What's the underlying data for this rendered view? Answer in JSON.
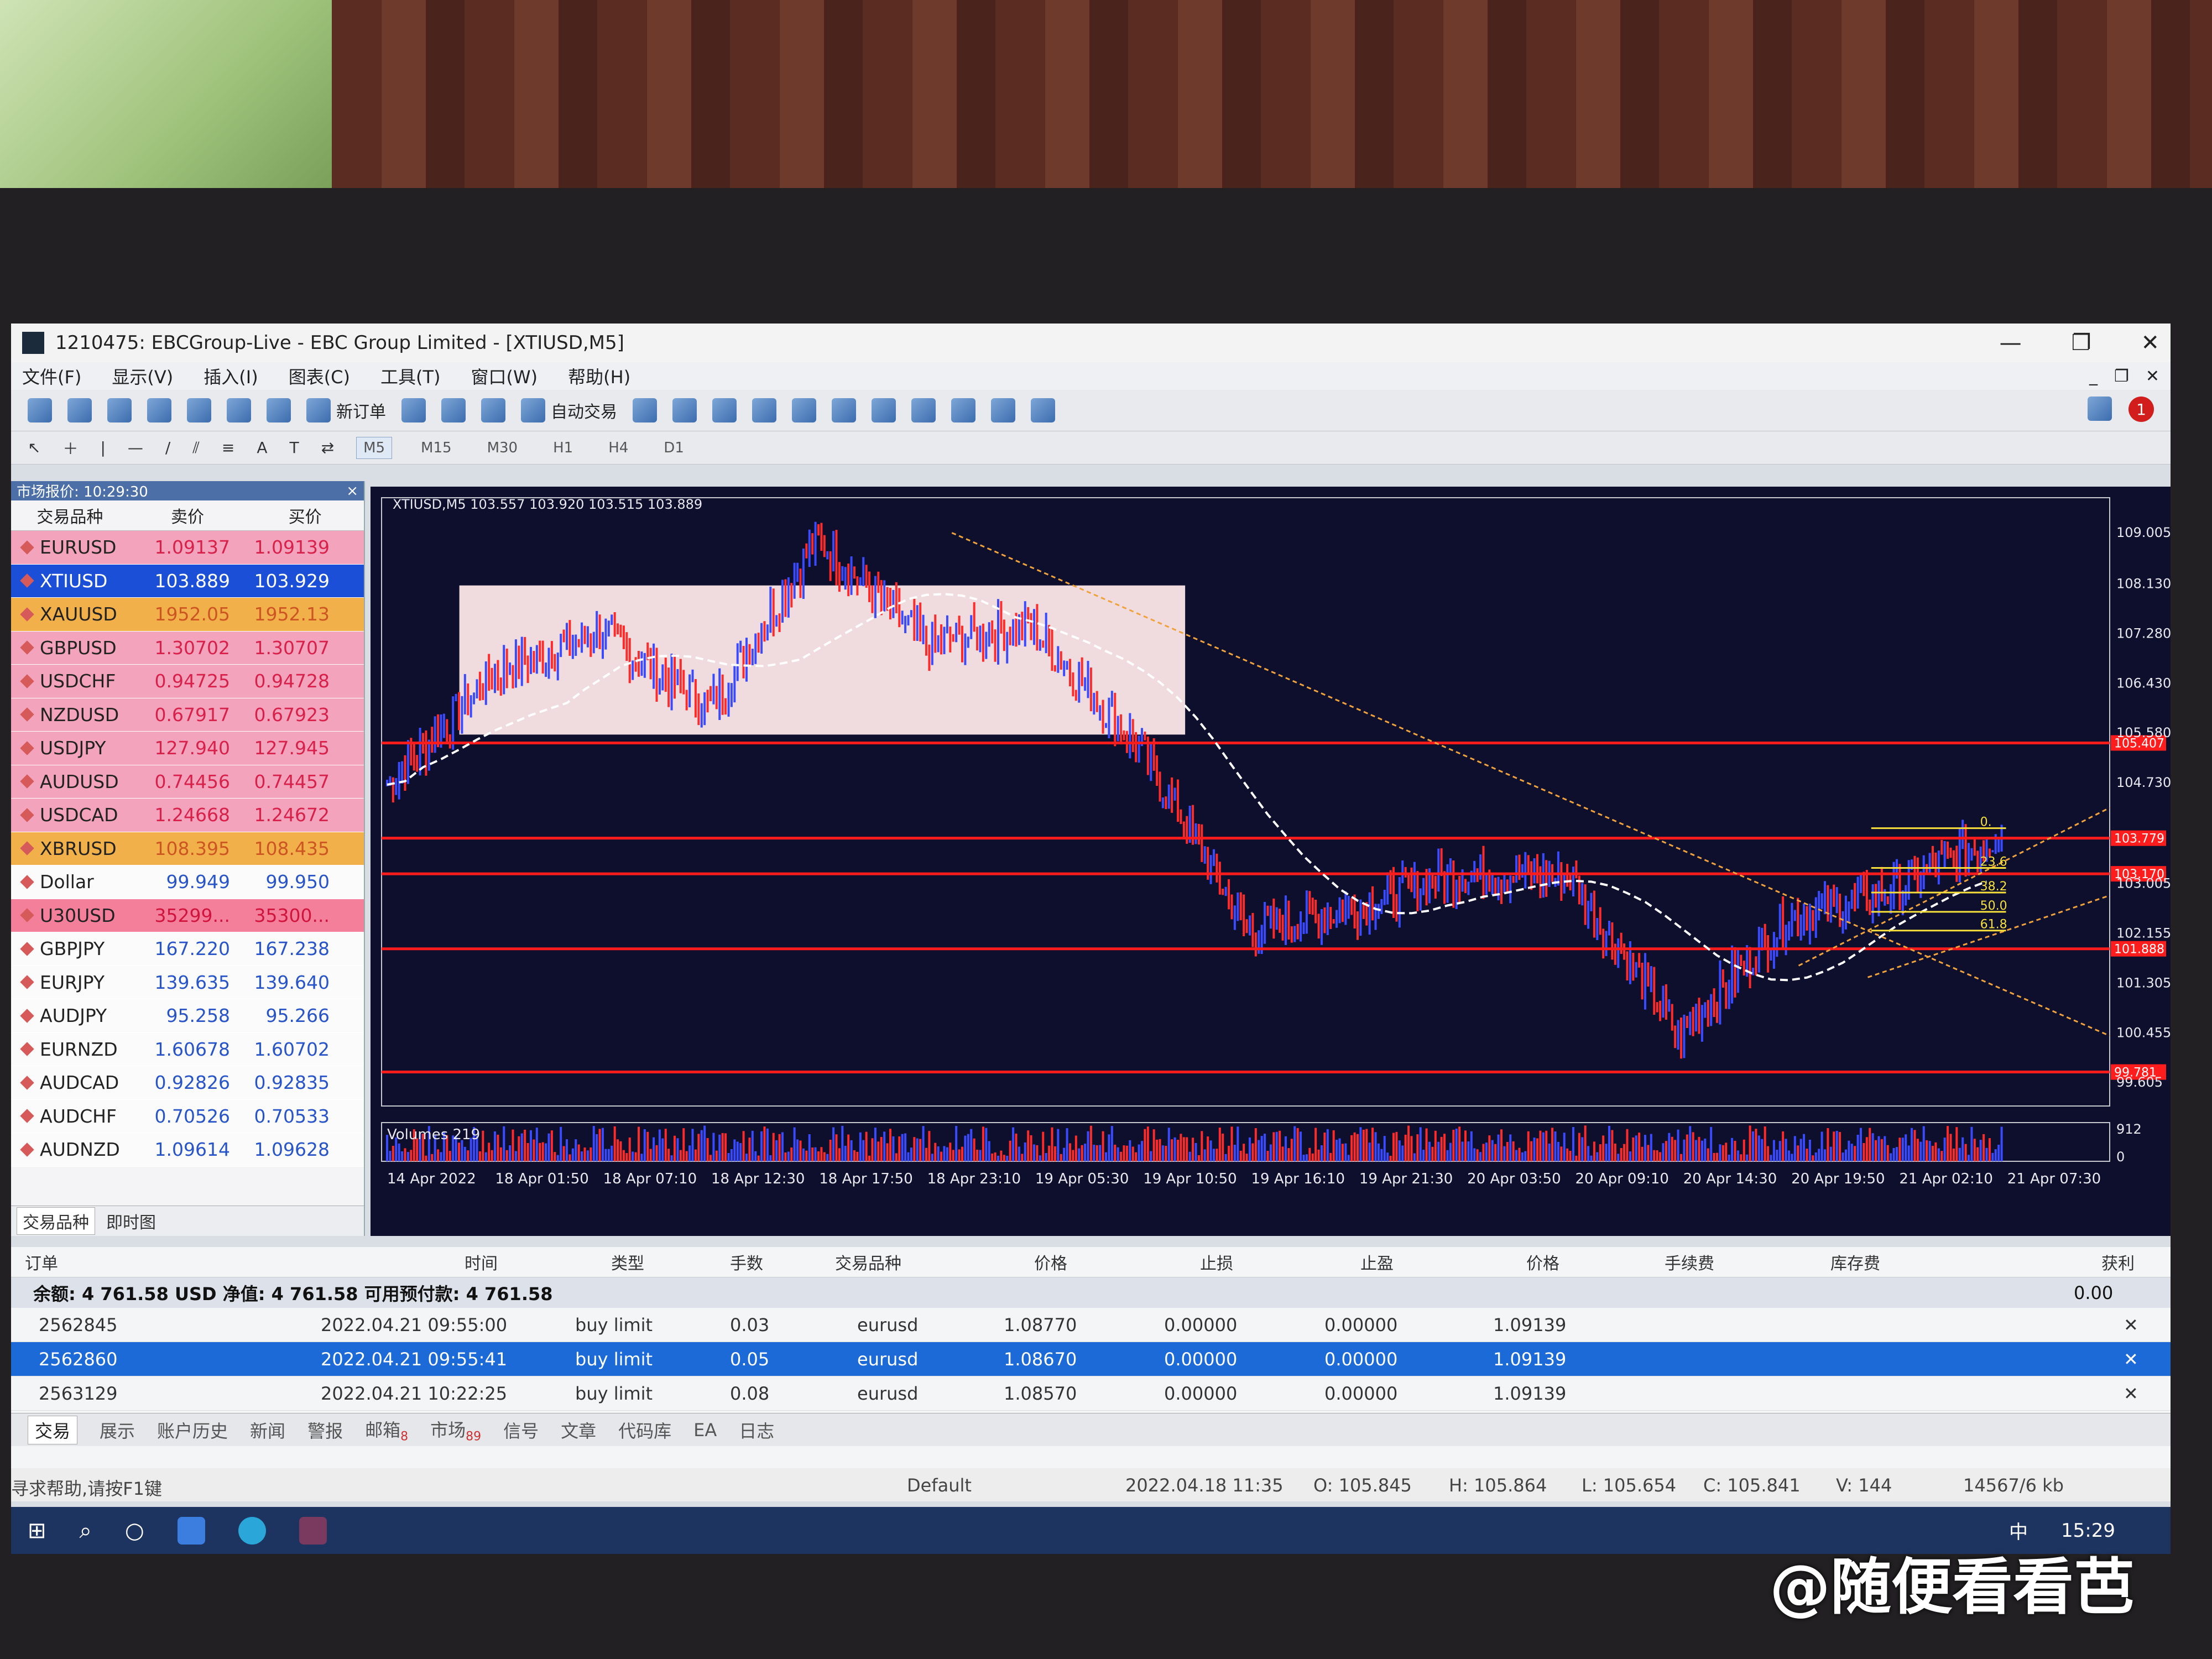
{
  "window": {
    "title": "1210475: EBCGroup-Live - EBC Group Limited - [XTIUSD,M5]",
    "min": "—",
    "max": "❐",
    "close": "✕"
  },
  "menu": [
    "文件(F)",
    "显示(V)",
    "插入(I)",
    "图表(C)",
    "工具(T)",
    "窗口(W)",
    "帮助(H)"
  ],
  "mdi": [
    "_",
    "❐",
    "✕"
  ],
  "toolbar": {
    "new_order": "新订单",
    "auto_trade": "自动交易",
    "alert_count": "1"
  },
  "timeframes": [
    "M5",
    "M15",
    "M30",
    "H1",
    "H4",
    "D1"
  ],
  "market": {
    "header": "市场报价: 10:29:30",
    "close": "×",
    "columns": [
      "交易品种",
      "卖价",
      "买价"
    ],
    "rows": [
      {
        "symbol": "EURUSD",
        "bid": "1.09137",
        "ask": "1.09139",
        "style": "pink"
      },
      {
        "symbol": "XTIUSD",
        "bid": "103.889",
        "ask": "103.929",
        "style": "sel"
      },
      {
        "symbol": "XAUUSD",
        "bid": "1952.05",
        "ask": "1952.13",
        "style": "orange"
      },
      {
        "symbol": "GBPUSD",
        "bid": "1.30702",
        "ask": "1.30707",
        "style": "pink"
      },
      {
        "symbol": "USDCHF",
        "bid": "0.94725",
        "ask": "0.94728",
        "style": "pink"
      },
      {
        "symbol": "NZDUSD",
        "bid": "0.67917",
        "ask": "0.67923",
        "style": "pink"
      },
      {
        "symbol": "USDJPY",
        "bid": "127.940",
        "ask": "127.945",
        "style": "pink"
      },
      {
        "symbol": "AUDUSD",
        "bid": "0.74456",
        "ask": "0.74457",
        "style": "pink"
      },
      {
        "symbol": "USDCAD",
        "bid": "1.24668",
        "ask": "1.24672",
        "style": "pink"
      },
      {
        "symbol": "XBRUSD",
        "bid": "108.395",
        "ask": "108.435",
        "style": "orange"
      },
      {
        "symbol": "Dollar",
        "bid": "99.949",
        "ask": "99.950",
        "style": "white"
      },
      {
        "symbol": "U30USD",
        "bid": "35299...",
        "ask": "35300...",
        "style": "pinkred"
      },
      {
        "symbol": "GBPJPY",
        "bid": "167.220",
        "ask": "167.238",
        "style": "white"
      },
      {
        "symbol": "EURJPY",
        "bid": "139.635",
        "ask": "139.640",
        "style": "white"
      },
      {
        "symbol": "AUDJPY",
        "bid": "95.258",
        "ask": "95.266",
        "style": "white"
      },
      {
        "symbol": "EURNZD",
        "bid": "1.60678",
        "ask": "1.60702",
        "style": "white"
      },
      {
        "symbol": "AUDCAD",
        "bid": "0.92826",
        "ask": "0.92835",
        "style": "white"
      },
      {
        "symbol": "AUDCHF",
        "bid": "0.70526",
        "ask": "0.70533",
        "style": "white"
      },
      {
        "symbol": "AUDNZD",
        "bid": "1.09614",
        "ask": "1.09628",
        "style": "white"
      }
    ],
    "tabs": [
      "交易品种",
      "即时图"
    ]
  },
  "chart": {
    "info": "XTIUSD,M5  103.557 103.920 103.515 103.889",
    "volumes_label": "Volumes 219",
    "vol_axis": [
      "912",
      "0"
    ],
    "price_ticks": [
      "109.005",
      "108.130",
      "107.280",
      "106.430",
      "105.580",
      "104.730",
      "103.005",
      "102.155",
      "101.305",
      "100.455",
      "99.605"
    ],
    "price_markers": [
      "105.407",
      "103.779",
      "103.170",
      "101.888",
      "99.781"
    ],
    "time_ticks": [
      "14 Apr 2022",
      "18 Apr 01:50",
      "18 Apr 07:10",
      "18 Apr 12:30",
      "18 Apr 17:50",
      "18 Apr 23:10",
      "19 Apr 05:30",
      "19 Apr 10:50",
      "19 Apr 16:10",
      "19 Apr 21:30",
      "20 Apr 03:50",
      "20 Apr 09:10",
      "20 Apr 14:30",
      "20 Apr 19:50",
      "21 Apr 02:10",
      "21 Apr 07:30"
    ],
    "fib_levels": [
      "0.",
      "23.6",
      "38.2",
      "50.0",
      "61.8"
    ],
    "colors": {
      "bg": "#0d0f2d",
      "up": "#3a4bff",
      "down": "#ff2a2a",
      "hline": "#ff1c1c",
      "fib": "#f7e03c",
      "trend": "#f0a23c",
      "ma": "#ffffff"
    }
  },
  "chart_data": {
    "type": "line",
    "title": "",
    "xlabel": "",
    "ylabel": "",
    "ylim": [
      99.2,
      109.6
    ],
    "series": [
      {
        "name": "XTIUSD,M5",
        "x": [
          "14 Apr 2022",
          "18 Apr 01:50",
          "18 Apr 07:10",
          "18 Apr 12:30",
          "18 Apr 17:50",
          "18 Apr 23:10",
          "19 Apr 05:30",
          "19 Apr 10:50",
          "19 Apr 16:10",
          "19 Apr 21:30",
          "20 Apr 03:50",
          "20 Apr 09:10",
          "20 Apr 14:30",
          "20 Apr 19:50",
          "21 Apr 02:10",
          "21 Apr 07:30"
        ],
        "values": [
          104.7,
          106.6,
          107.3,
          106.0,
          108.9,
          107.1,
          107.4,
          105.3,
          102.2,
          102.6,
          103.2,
          103.1,
          100.4,
          102.4,
          102.9,
          103.9
        ]
      }
    ],
    "horizontal_lines": [
      105.407,
      103.779,
      103.17,
      101.888,
      99.781
    ]
  },
  "terminal": {
    "columns": [
      "订单",
      "时间",
      "类型",
      "手数",
      "交易品种",
      "价格",
      "止损",
      "止盈",
      "价格",
      "手续费",
      "库存费",
      "获利"
    ],
    "balance": "余额: 4 761.58 USD  净值: 4 761.58  可用预付款: 4 761.58",
    "total_profit": "0.00",
    "orders": [
      {
        "id": "2562845",
        "time": "2022.04.21 09:55:00",
        "type": "buy limit",
        "lots": "0.03",
        "symbol": "eurusd",
        "price": "1.08770",
        "sl": "0.00000",
        "tp": "0.00000",
        "cur": "1.09139",
        "sel": false
      },
      {
        "id": "2562860",
        "time": "2022.04.21 09:55:41",
        "type": "buy limit",
        "lots": "0.05",
        "symbol": "eurusd",
        "price": "1.08670",
        "sl": "0.00000",
        "tp": "0.00000",
        "cur": "1.09139",
        "sel": true
      },
      {
        "id": "2563129",
        "time": "2022.04.21 10:22:25",
        "type": "buy limit",
        "lots": "0.08",
        "symbol": "eurusd",
        "price": "1.08570",
        "sl": "0.00000",
        "tp": "0.00000",
        "cur": "1.09139",
        "sel": false
      }
    ],
    "tabs": [
      "交易",
      "展示",
      "账户历史",
      "新闻",
      "警报",
      "邮箱",
      "市场",
      "信号",
      "文章",
      "代码库",
      "EA",
      "日志"
    ],
    "mail_count": "8",
    "market_count": "89"
  },
  "status": {
    "help": "寻求帮助,请按F1键",
    "profile": "Default",
    "time": "2022.04.18 11:35",
    "o": "O: 105.845",
    "h": "H: 105.864",
    "l": "L: 105.654",
    "c": "C: 105.841",
    "v": "V: 144",
    "mem": "14567/6 kb"
  },
  "taskbar": {
    "clock": "15:29",
    "ime": "中"
  },
  "watermark": "@随便看看芭"
}
